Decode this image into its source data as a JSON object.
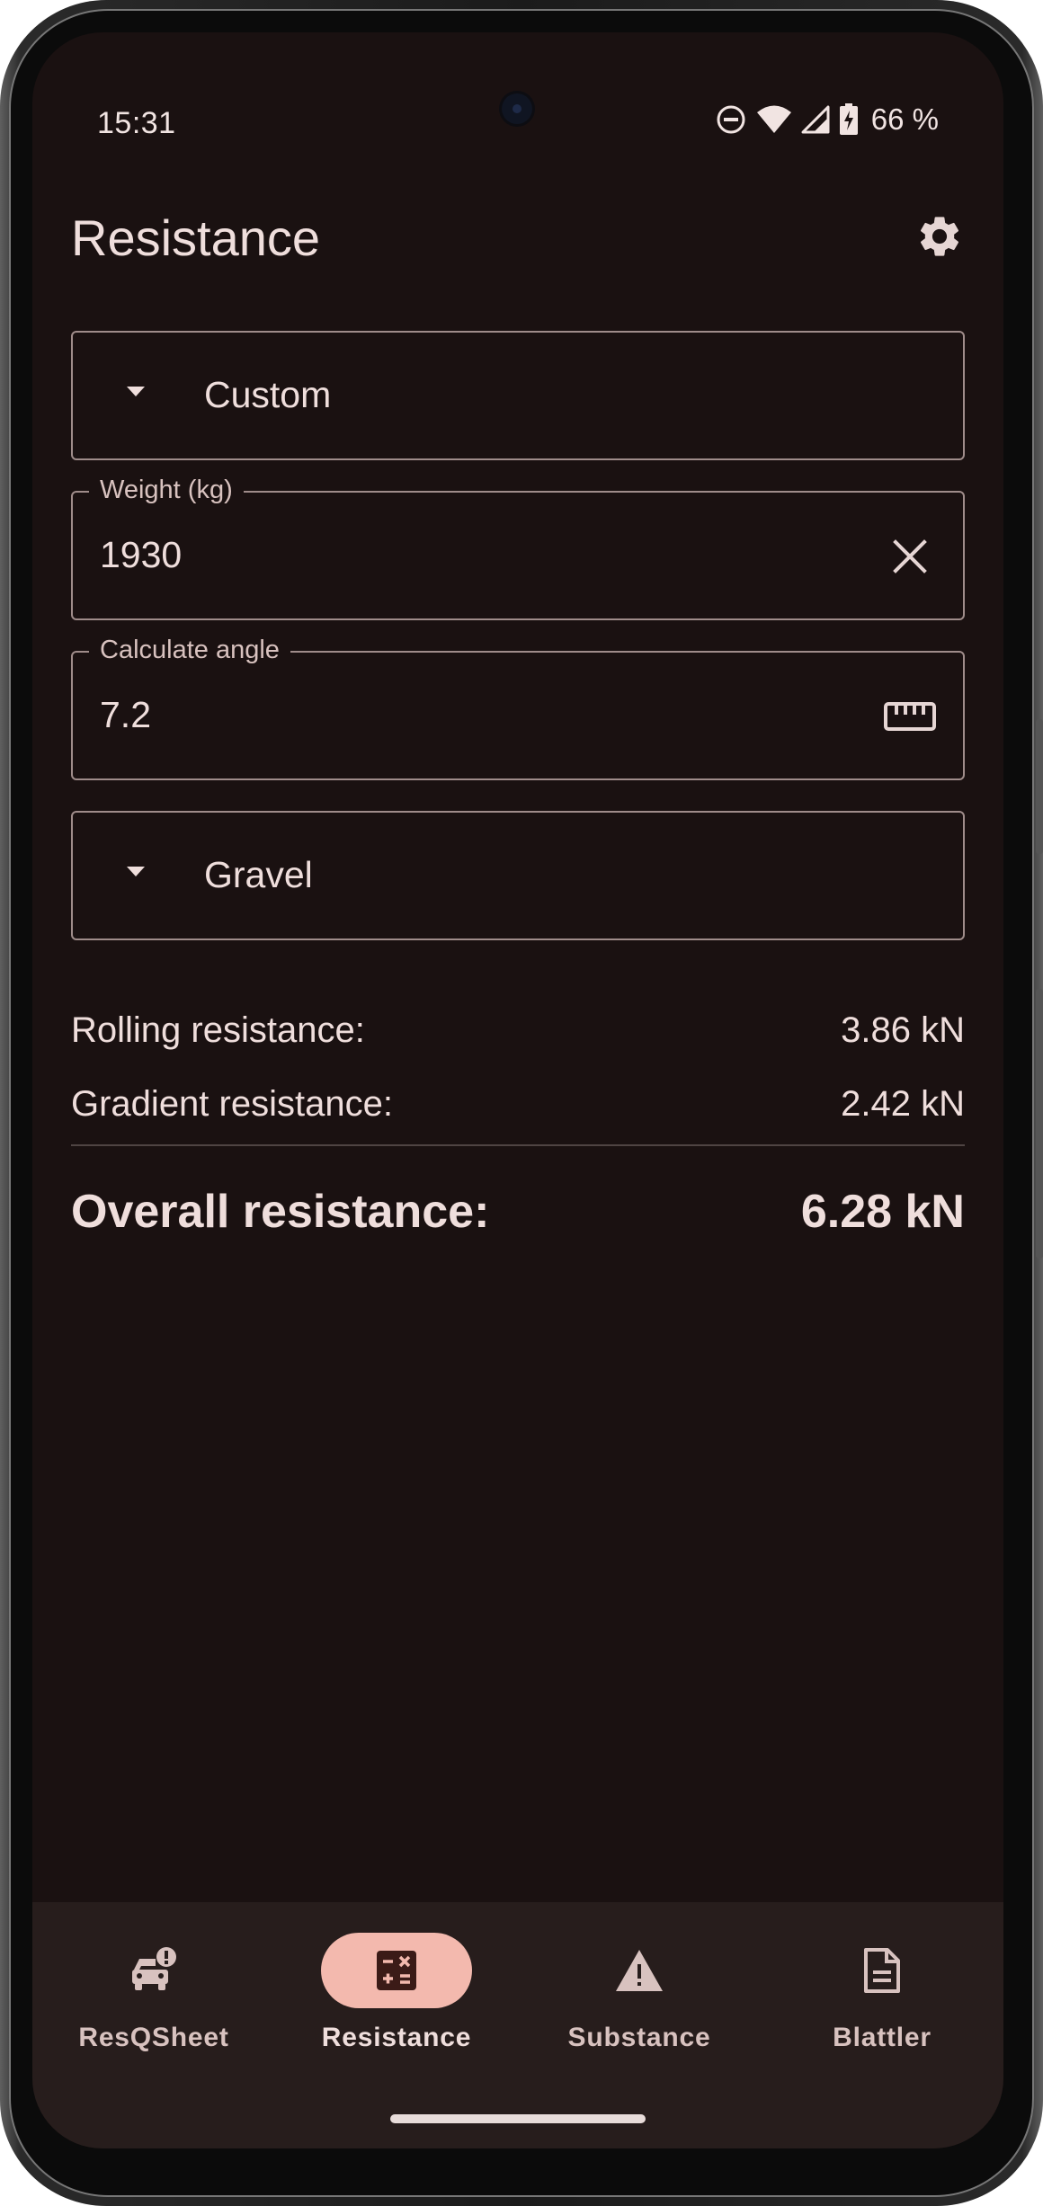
{
  "status_bar": {
    "time": "15:31",
    "battery": "66 %",
    "icons": [
      "do-not-disturb-icon",
      "wifi-icon",
      "cell-signal-icon",
      "battery-charging-icon"
    ]
  },
  "app_bar": {
    "title": "Resistance",
    "settings_icon": "gear-icon"
  },
  "form": {
    "vehicle_type": {
      "value": "Custom"
    },
    "weight": {
      "label": "Weight (kg)",
      "value": "1930",
      "trailing_icon": "close-icon"
    },
    "angle": {
      "label": "Calculate angle",
      "value": "7.2",
      "trailing_icon": "ruler-icon"
    },
    "surface": {
      "value": "Gravel"
    }
  },
  "results": {
    "rolling": {
      "label": "Rolling resistance:",
      "value": "3.86 kN"
    },
    "gradient": {
      "label": "Gradient resistance:",
      "value": "2.42 kN"
    },
    "overall": {
      "label": "Overall resistance:",
      "value": "6.28 kN"
    }
  },
  "nav": {
    "items": [
      {
        "label": "ResQSheet",
        "icon": "car-alert-icon",
        "active": false
      },
      {
        "label": "Resistance",
        "icon": "calculator-icon",
        "active": true
      },
      {
        "label": "Substance",
        "icon": "warning-icon",
        "active": false
      },
      {
        "label": "Blattler",
        "icon": "document-icon",
        "active": false
      }
    ]
  },
  "colors": {
    "background": "#1a1111",
    "on_surface": "#efdedc",
    "outline": "#9f8c8a",
    "nav_background": "#271d1c",
    "active_indicator": "#f3b9ae"
  }
}
